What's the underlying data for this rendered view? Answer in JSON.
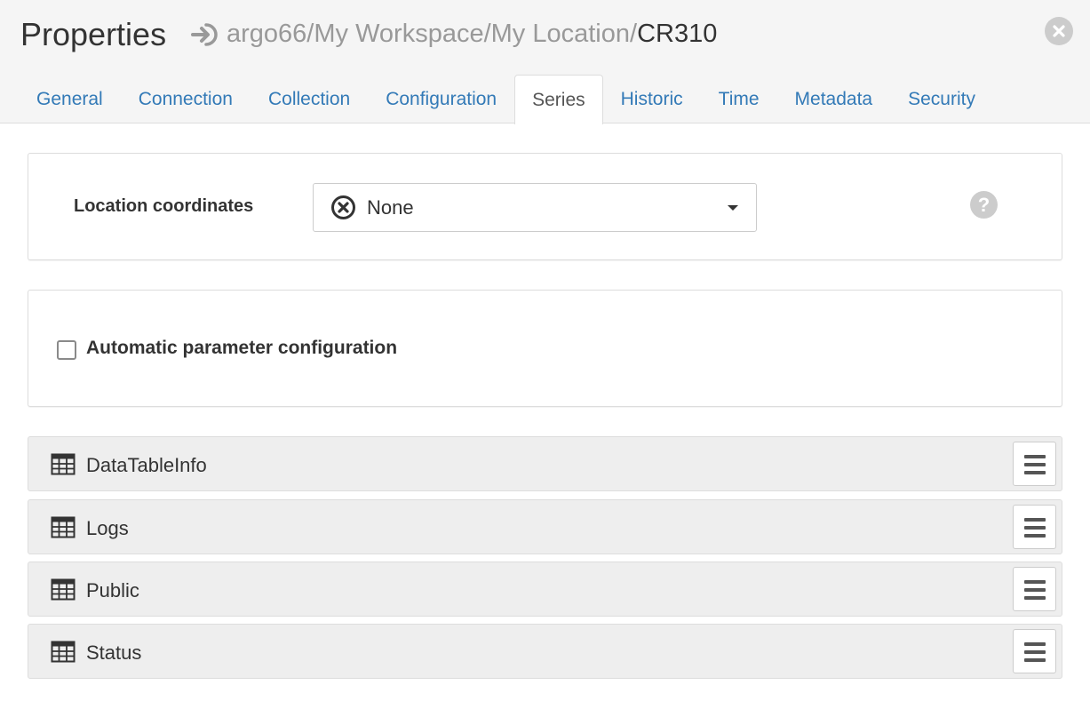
{
  "header": {
    "title": "Properties",
    "breadcrumb_path": "argo66/My Workspace/My Location/",
    "breadcrumb_current": "CR310",
    "icons": {
      "breadcrumb": "sign-in-arrow-icon",
      "close": "close-circle-icon"
    }
  },
  "tabs": [
    {
      "label": "General",
      "active": false
    },
    {
      "label": "Connection",
      "active": false
    },
    {
      "label": "Collection",
      "active": false
    },
    {
      "label": "Configuration",
      "active": false
    },
    {
      "label": "Series",
      "active": true
    },
    {
      "label": "Historic",
      "active": false
    },
    {
      "label": "Time",
      "active": false
    },
    {
      "label": "Metadata",
      "active": false
    },
    {
      "label": "Security",
      "active": false
    }
  ],
  "coordinates": {
    "label": "Location coordinates",
    "selected": "None",
    "icons": {
      "value": "x-circle-icon",
      "help": "question-circle-icon"
    }
  },
  "auto_config": {
    "label": "Automatic parameter configuration",
    "checked": false
  },
  "series": [
    {
      "name": "DataTableInfo"
    },
    {
      "name": "Logs"
    },
    {
      "name": "Public"
    },
    {
      "name": "Status"
    }
  ],
  "colors": {
    "link": "#337ab7",
    "header_bg": "#f5f5f5",
    "row_bg": "#eeeeee",
    "border": "#dddddd",
    "icon_gray": "#cccccc"
  }
}
